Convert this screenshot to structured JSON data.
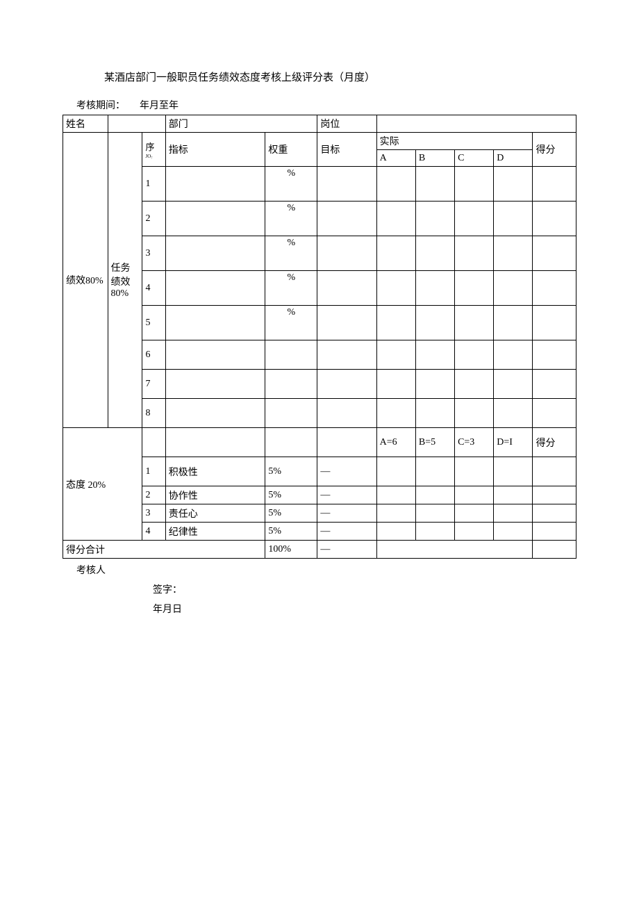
{
  "title": "某酒店部门一般职员任务绩效态度考核上级评分表（月度）",
  "periodLabel": "考核期间：",
  "periodValue": "年月至年",
  "header": {
    "name": "姓名",
    "dept": "部门",
    "position": "岗位"
  },
  "cols": {
    "seq": "序",
    "seqSub": "JO₇",
    "indicator": "指标",
    "weight": "权重",
    "target": "目标",
    "actual": "实际",
    "a": "A",
    "b": "B",
    "c": "C",
    "d": "D",
    "score": "得分"
  },
  "leftGroup1": "绩效80%",
  "leftGroup2": "任务绩效80%",
  "perfRows": [
    {
      "n": "1",
      "pct": "%"
    },
    {
      "n": "2",
      "pct": "%"
    },
    {
      "n": "3",
      "pct": "%"
    },
    {
      "n": "4",
      "pct": "%"
    },
    {
      "n": "5",
      "pct": "%"
    },
    {
      "n": "6",
      "pct": ""
    },
    {
      "n": "7",
      "pct": ""
    },
    {
      "n": "8",
      "pct": ""
    }
  ],
  "attitudeHeader": {
    "a": "A=6",
    "b": "B=5",
    "c": "C=3",
    "d": "D=I",
    "score": "得分"
  },
  "attitudeLabel": "态度 20%",
  "attitudeRows": [
    {
      "n": "1",
      "name": "积极性",
      "w": "5%",
      "t": "—"
    },
    {
      "n": "2",
      "name": "协作性",
      "w": "5%",
      "t": "—"
    },
    {
      "n": "3",
      "name": "责任心",
      "w": "5%",
      "t": "—"
    },
    {
      "n": "4",
      "name": "纪律性",
      "w": "5%",
      "t": "—"
    }
  ],
  "totalLabel": "得分合计",
  "totalWeight": "100%",
  "totalTarget": "—",
  "footer": {
    "assessor": "考核人",
    "sign": "签字：",
    "date": "年月日"
  }
}
